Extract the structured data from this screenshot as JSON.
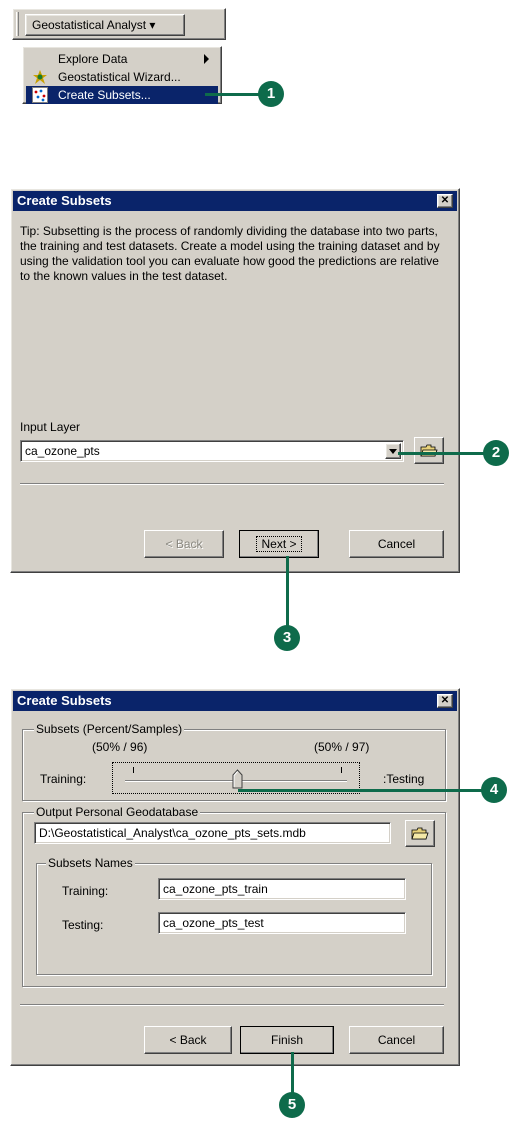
{
  "toolbar": {
    "menu_label": "Geostatistical Analyst ▾"
  },
  "menu": {
    "items": [
      {
        "label": "Explore Data",
        "has_submenu": true
      },
      {
        "label": "Geostatistical Wizard..."
      },
      {
        "label": "Create Subsets...",
        "highlighted": true
      }
    ]
  },
  "dialog1": {
    "title": "Create Subsets",
    "close_glyph": "✕",
    "tip": "Tip:  Subsetting is the process of randomly dividing the database into two parts, the training and test datasets. Create a model using the training dataset and by using the validation tool you can evaluate how good the predictions are relative to the known values in the test dataset.",
    "input_label": "Input Layer",
    "input_value": "ca_ozone_pts",
    "back_label": "< Back",
    "next_label": "Next >",
    "cancel_label": "Cancel"
  },
  "dialog2": {
    "title": "Create Subsets",
    "close_glyph": "✕",
    "subsets_group": "Subsets (Percent/Samples)",
    "left_pct": "(50% / 96)",
    "right_pct": "(50% / 97)",
    "training_label": "Training:",
    "testing_label": ":Testing",
    "slider_fraction": 0.5,
    "output_group": "Output Personal Geodatabase",
    "output_path": "D:\\Geostatistical_Analyst\\ca_ozone_pts_sets.mdb",
    "names_group": "Subsets Names",
    "train_label": "Training:",
    "train_value": "ca_ozone_pts_train",
    "test_label": "Testing:",
    "test_value": "ca_ozone_pts_test",
    "back_label": "< Back",
    "finish_label": "Finish",
    "cancel_label": "Cancel"
  },
  "callouts": [
    "1",
    "2",
    "3",
    "4",
    "5"
  ],
  "colors": {
    "titlebar": "#0a246a",
    "callout": "#0e6b4b",
    "dialog": "#d4d0c8"
  }
}
